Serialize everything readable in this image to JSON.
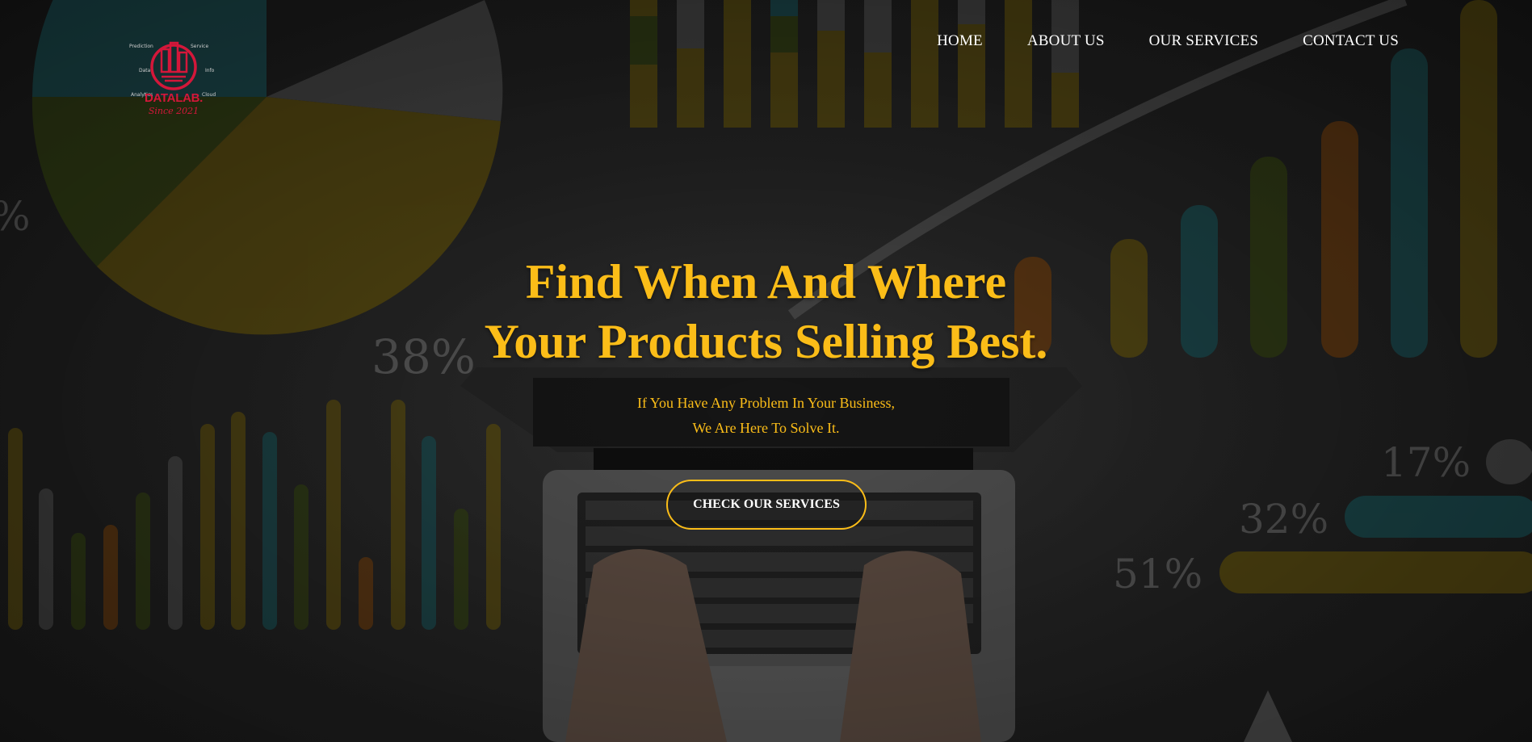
{
  "brand": {
    "name": "DATALAB.",
    "tagline": "Since 2021",
    "color": "#d4173a"
  },
  "nav": {
    "items": [
      {
        "label": "HOME"
      },
      {
        "label": "ABOUT US"
      },
      {
        "label": "OUR SERVICES"
      },
      {
        "label": "CONTACT US"
      }
    ]
  },
  "hero": {
    "headline_line1": "Find When And Where",
    "headline_line2": "Your Products Selling Best.",
    "subtitle_line1": "If You Have Any Problem In Your Business,",
    "subtitle_line2": "We Are Here To Solve It.",
    "cta_label": "CHECK OUR SERVICES",
    "background_labels": [
      "38%",
      "17%",
      "32%",
      "51%",
      "%"
    ]
  },
  "colors": {
    "accent": "#fbbd18",
    "nav_text": "#ffffff",
    "background": "#2a2a2a"
  }
}
